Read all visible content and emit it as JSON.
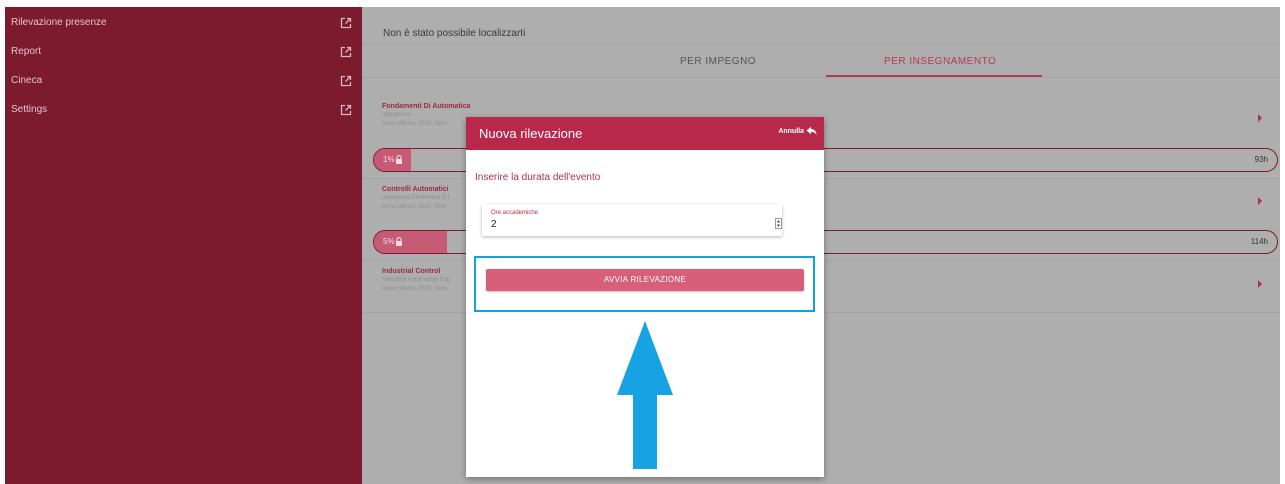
{
  "sidebar": {
    "items": [
      {
        "label": "Rilevazione presenze",
        "icon": "external-link-icon"
      },
      {
        "label": "Report",
        "icon": "external-link-icon"
      },
      {
        "label": "Cineca",
        "icon": "external-link-icon"
      },
      {
        "label": "Settings",
        "icon": "external-link-icon"
      }
    ]
  },
  "main": {
    "location_message": "Non è stato possibile localizzarti",
    "tabs": [
      {
        "label": "PER IMPEGNO",
        "active": false
      },
      {
        "label": "PER INSEGNAMENTO",
        "active": true
      }
    ],
    "courses": [
      {
        "title": "Fondamenti Di Automatica",
        "line1": "Ingegneria",
        "line2": "Anno offerta: 2020, Sem",
        "progress_label": "1%",
        "progress": 1,
        "hours": "93h"
      },
      {
        "title": "Controlli Automatici",
        "line1": "Ingegneria Elettronica E I",
        "line2": "Anno offerta: 2020, Prec",
        "progress_label": "5%",
        "progress": 5,
        "hours": "114h"
      },
      {
        "title": "Industrial Control",
        "line1": "Industrial Automation Eng",
        "line2": "Anno offerta: 2020, Sem"
      }
    ]
  },
  "modal": {
    "title": "Nuova rilevazione",
    "cancel_label": "Annulla",
    "prompt": "Inserire la durata dell'evento",
    "field_label": "Ore accademiche",
    "field_value": "2",
    "button_label": "AVVIA RILEVAZIONE"
  },
  "colors": {
    "sidebar": "#7c1a2e",
    "accent": "#b8284a",
    "button": "#d85f7a",
    "highlight": "#0ea2e2"
  }
}
